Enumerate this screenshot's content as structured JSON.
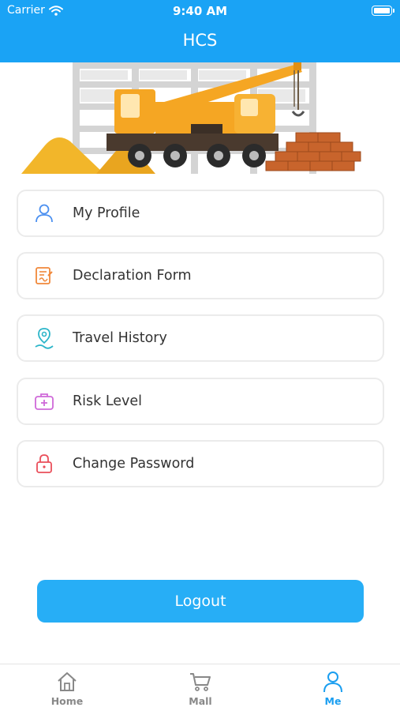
{
  "status_bar": {
    "carrier": "Carrier",
    "time": "9:40 AM"
  },
  "header": {
    "title": "HCS"
  },
  "menu": [
    {
      "label": "My Profile",
      "icon": "user-icon",
      "color": "#4a8ff0"
    },
    {
      "label": "Declaration Form",
      "icon": "form-icon",
      "color": "#f0883a"
    },
    {
      "label": "Travel History",
      "icon": "location-pin-icon",
      "color": "#2bb5c9"
    },
    {
      "label": "Risk Level",
      "icon": "medical-kit-icon",
      "color": "#cf6ad9"
    },
    {
      "label": "Change Password",
      "icon": "lock-icon",
      "color": "#ea4e5a"
    }
  ],
  "logout": {
    "label": "Logout"
  },
  "tabbar": {
    "tabs": [
      {
        "label": "Home",
        "icon": "home-icon",
        "active": false
      },
      {
        "label": "Mall",
        "icon": "cart-icon",
        "active": false
      },
      {
        "label": "Me",
        "icon": "user-icon",
        "active": true
      }
    ]
  },
  "colors": {
    "primary": "#1aa3f5",
    "button": "#27aef6",
    "active_tab": "#1a9ef0"
  }
}
